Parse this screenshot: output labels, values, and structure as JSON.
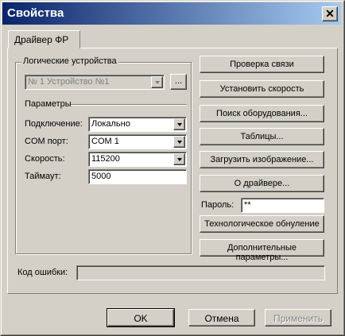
{
  "window": {
    "title": "Свойства"
  },
  "tabs": [
    {
      "label": "Драйвер ФР"
    }
  ],
  "logical_devices": {
    "group_label": "Логические устройства",
    "selected": "№ 1 Устройство №1",
    "browse_label": "..."
  },
  "params": {
    "group_label": "Параметры",
    "connection_label": "Подключение:",
    "connection_value": "Локально",
    "com_label": "COM порт:",
    "com_value": "COM 1",
    "speed_label": "Скорость:",
    "speed_value": "115200",
    "timeout_label": "Таймаут:",
    "timeout_value": "5000"
  },
  "actions": {
    "check_connection": "Проверка связи",
    "set_speed": "Установить скорость",
    "search_equipment": "Поиск оборудования...",
    "tables": "Таблицы...",
    "load_image": "Загрузить изображение...",
    "about_driver": "О драйвере...",
    "password_label": "Пароль:",
    "password_value": "**",
    "tech_reset": "Технологическое обнуление",
    "extra_params": "Дополнительные параметры..."
  },
  "error": {
    "label": "Код ошибки:",
    "value": ""
  },
  "footer": {
    "ok": "OK",
    "cancel": "Отмена",
    "apply": "Применить"
  }
}
